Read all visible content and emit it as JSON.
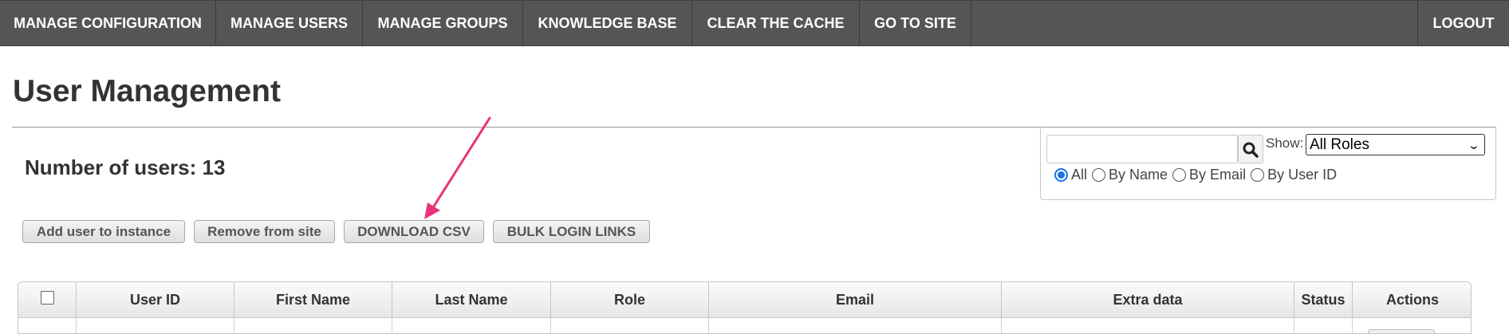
{
  "nav": {
    "items": [
      {
        "label": "MANAGE CONFIGURATION"
      },
      {
        "label": "MANAGE USERS"
      },
      {
        "label": "MANAGE GROUPS"
      },
      {
        "label": "KNOWLEDGE BASE"
      },
      {
        "label": "CLEAR THE CACHE"
      },
      {
        "label": "GO TO SITE"
      }
    ],
    "logout_label": "LOGOUT"
  },
  "page": {
    "title": "User Management",
    "user_count_text": "Number of users: 13"
  },
  "search": {
    "value": "",
    "placeholder": "",
    "show_label": "Show:",
    "role_selected": "All Roles",
    "filters": [
      {
        "label": "All",
        "checked": true
      },
      {
        "label": "By Name",
        "checked": false
      },
      {
        "label": "By Email",
        "checked": false
      },
      {
        "label": "By User ID",
        "checked": false
      }
    ]
  },
  "actions": {
    "add_user": "Add user to instance",
    "remove": "Remove from site",
    "download_csv": "DOWNLOAD CSV",
    "bulk_links": "BULK LOGIN LINKS"
  },
  "table": {
    "columns": [
      "User ID",
      "First Name",
      "Last Name",
      "Role",
      "Email",
      "Extra data",
      "Status",
      "Actions"
    ]
  },
  "colors": {
    "nav_bg": "#555555",
    "arrow": "#e8337a",
    "radio_accent": "#1a73e8"
  }
}
